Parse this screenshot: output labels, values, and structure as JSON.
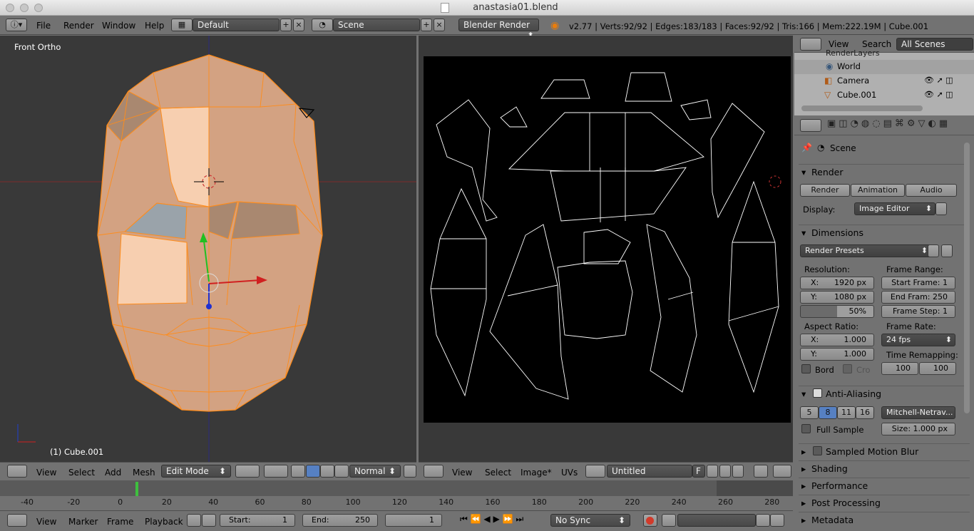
{
  "window": {
    "title": "anastasia01.blend"
  },
  "info": {
    "menus": [
      "File",
      "Render",
      "Window",
      "Help"
    ],
    "layout": "Default",
    "scene": "Scene",
    "engine": "Blender Render",
    "stats": "v2.77 | Verts:92/92 | Edges:183/183 | Faces:92/92 | Tris:166 | Mem:222.19M | Cube.001"
  },
  "viewport3d": {
    "view_label": "Front Ortho",
    "object_label": "(1) Cube.001",
    "menus": [
      "View",
      "Select",
      "Add",
      "Mesh"
    ],
    "mode": "Edit Mode",
    "orientation": "Normal"
  },
  "uv_editor": {
    "menus": [
      "View",
      "Select",
      "Image*",
      "UVs"
    ],
    "image_name": "Untitled",
    "f_label": "F"
  },
  "timeline": {
    "ticks": [
      "-40",
      "-20",
      "0",
      "20",
      "40",
      "60",
      "80",
      "100",
      "120",
      "140",
      "160",
      "180",
      "200",
      "220",
      "240",
      "260",
      "280"
    ],
    "menus": [
      "View",
      "Marker",
      "Frame",
      "Playback"
    ],
    "start_label": "Start:",
    "start_value": "1",
    "end_label": "End:",
    "end_value": "250",
    "current": "1",
    "sync": "No Sync"
  },
  "outliner": {
    "menus": [
      "View",
      "Search"
    ],
    "filter": "All Scenes",
    "items": [
      {
        "name": "RenderLayers"
      },
      {
        "name": "World"
      },
      {
        "name": "Camera"
      },
      {
        "name": "Cube.001"
      }
    ]
  },
  "properties": {
    "breadcrumb": "Scene",
    "render": {
      "title": "Render",
      "buttons": [
        "Render",
        "Animation",
        "Audio"
      ],
      "display_label": "Display:",
      "display_value": "Image Editor"
    },
    "dimensions": {
      "title": "Dimensions",
      "presets": "Render Presets",
      "resolution_label": "Resolution:",
      "res_x": "X:",
      "res_x_value": "1920 px",
      "res_y": "Y:",
      "res_y_value": "1080 px",
      "res_pct": "50%",
      "frame_range_label": "Frame Range:",
      "start_frame": "Start Frame: 1",
      "end_frame": "End Fram: 250",
      "frame_step": "Frame Step: 1",
      "aspect_label": "Aspect Ratio:",
      "asp_x_value": "1.000",
      "asp_y_value": "1.000",
      "frame_rate_label": "Frame Rate:",
      "frame_rate": "24 fps",
      "time_remap_label": "Time Remapping:",
      "remap_old": "100",
      "remap_new": "100",
      "border": "Bord",
      "crop": "Cro"
    },
    "aa": {
      "title": "Anti-Aliasing",
      "samples": [
        "5",
        "8",
        "11",
        "16"
      ],
      "filter": "Mitchell-Netrav...",
      "full_sample": "Full Sample",
      "size": "Size: 1.000 px"
    },
    "collapsed": [
      "Sampled Motion Blur",
      "Shading",
      "Performance",
      "Post Processing",
      "Metadata"
    ]
  },
  "colors": {
    "accent": "#5680c2",
    "selected_edge": "#ff8c1a",
    "mesh_face": "#d9a985"
  }
}
